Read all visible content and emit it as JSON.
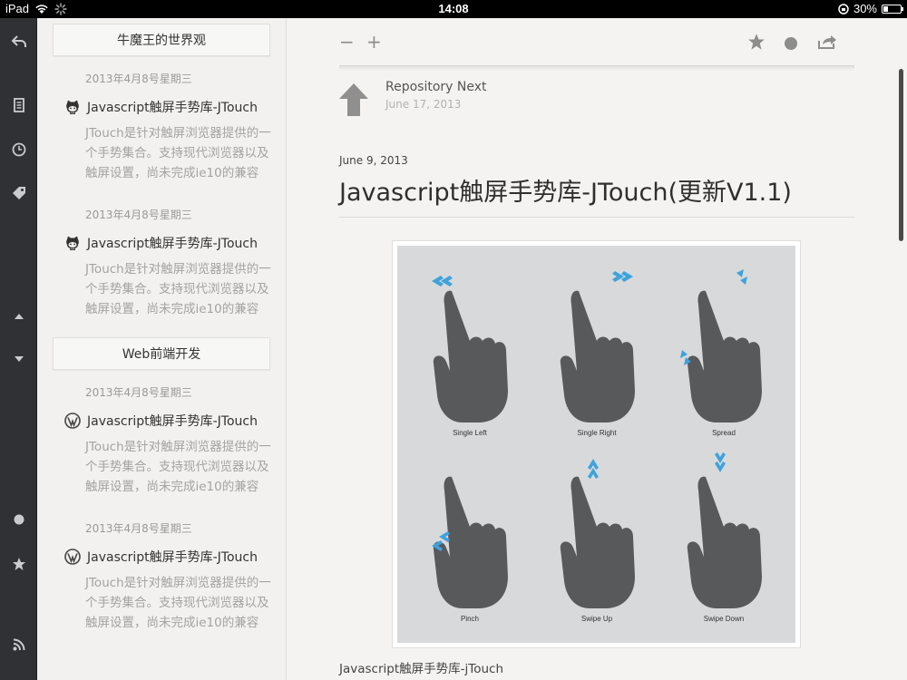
{
  "status_bar": {
    "device": "iPad",
    "time": "14:08",
    "battery": "30%",
    "battery_level": 0.3
  },
  "toolbar": {
    "icons": [
      "back-arrow-icon",
      "document-icon",
      "clock-icon",
      "tag-icon",
      "arrow-up-icon",
      "arrow-down-icon",
      "circle-icon",
      "star-icon",
      "rss-icon"
    ]
  },
  "sidebar": {
    "groups": [
      {
        "header": "牛魔王的世界观",
        "items": [
          {
            "date": "2013年4月8号星期三",
            "title": "Javascript触屏手势库-JTouch",
            "source_icon": "github-octocat-icon",
            "excerpt": "JTouch是针对触屏浏览器提供的一个手势集合。支持现代浏览器以及触屏设置，尚未完成ie10的兼容"
          },
          {
            "date": "2013年4月8号星期三",
            "title": "Javascript触屏手势库-JTouch",
            "source_icon": "github-octocat-icon",
            "excerpt": "JTouch是针对触屏浏览器提供的一个手势集合。支持现代浏览器以及触屏设置，尚未完成ie10的兼容"
          }
        ]
      },
      {
        "header": "Web前端开发",
        "items": [
          {
            "date": "2013年4月8号星期三",
            "title": "Javascript触屏手势库-JTouch",
            "source_icon": "wordpress-icon",
            "excerpt": "JTouch是针对触屏浏览器提供的一个手势集合。支持现代浏览器以及触屏设置，尚未完成ie10的兼容"
          },
          {
            "date": "2013年4月8号星期三",
            "title": "Javascript触屏手势库-JTouch",
            "source_icon": "wordpress-icon",
            "excerpt": "JTouch是针对触屏浏览器提供的一个手势集合。支持现代浏览器以及触屏设置，尚未完成ie10的兼容"
          }
        ]
      }
    ]
  },
  "main": {
    "toolbar": {
      "minus": "−",
      "plus": "+"
    },
    "next": {
      "title": "Repository Next",
      "date": "June 17, 2013"
    },
    "article": {
      "date": "June 9, 2013",
      "title": "Javascript触屏手势库-JTouch(更新V1.1)",
      "caption": "Javascript触屏手势库-jTouch"
    },
    "figure": {
      "gestures": [
        "Single  Left",
        "Single  Right",
        "Spread",
        "Pinch",
        "Swipe Up",
        "Swipe Down"
      ],
      "hand_color": "#58595b",
      "arrow_color": "#3ea3dc"
    }
  }
}
